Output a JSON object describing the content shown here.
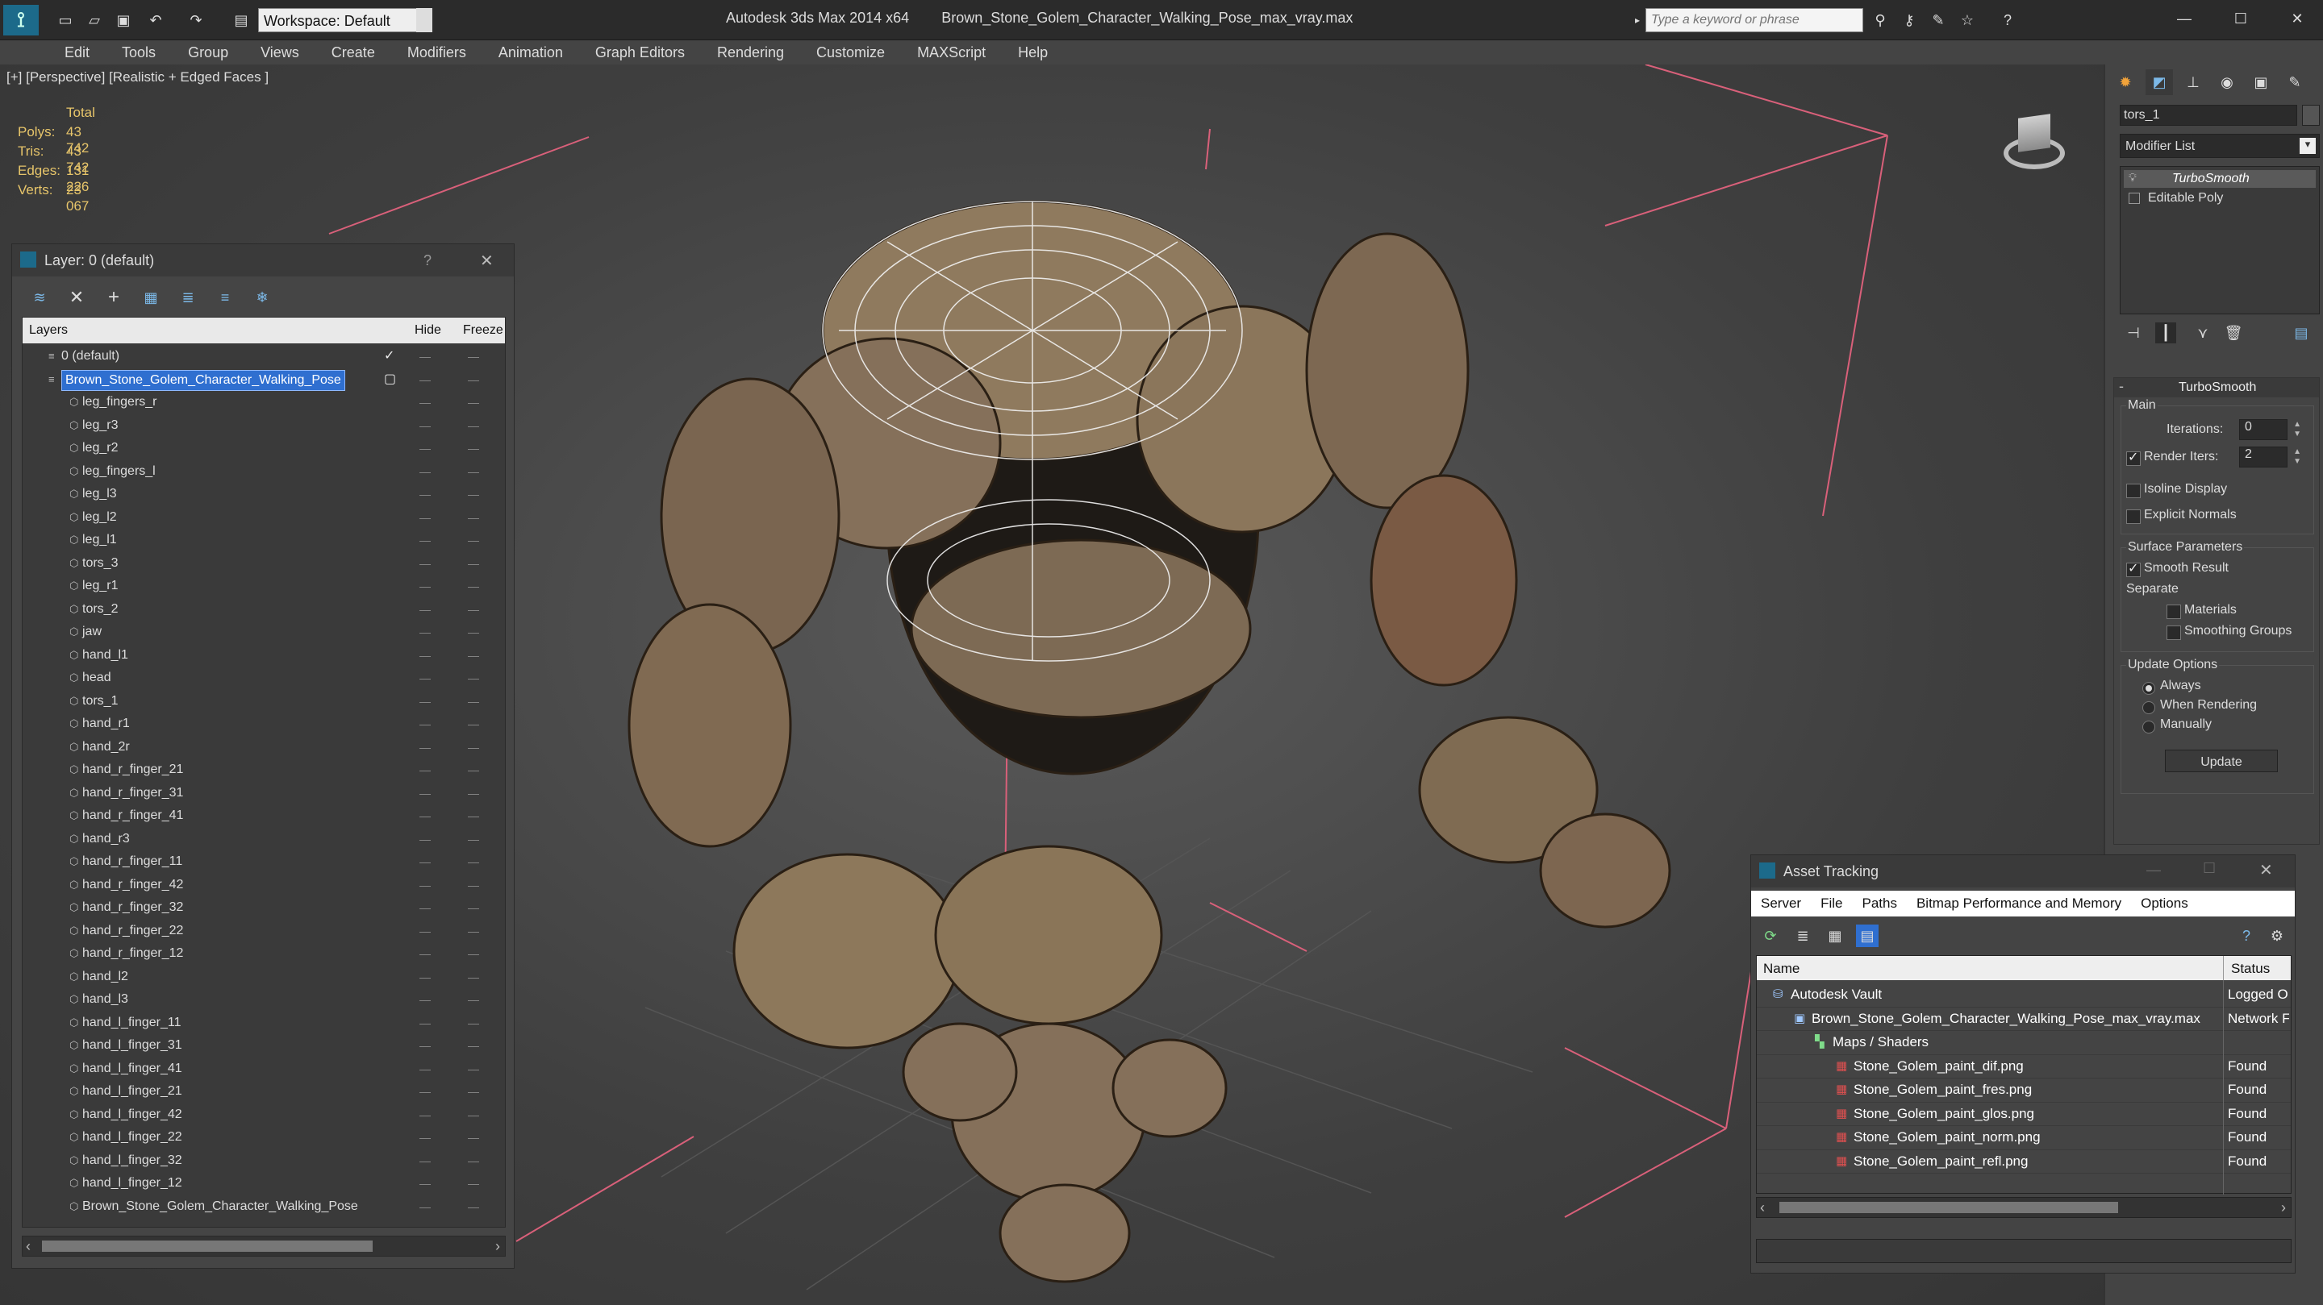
{
  "titlebar": {
    "app_title": "Autodesk 3ds Max  2014 x64",
    "file_title": "Brown_Stone_Golem_Character_Walking_Pose_max_vray.max",
    "workspace": "Workspace: Default",
    "search_placeholder": "Type a keyword or phrase"
  },
  "menu": [
    "Edit",
    "Tools",
    "Group",
    "Views",
    "Create",
    "Modifiers",
    "Animation",
    "Graph Editors",
    "Rendering",
    "Customize",
    "MAXScript",
    "Help"
  ],
  "viewport": {
    "label": "[+] [Perspective] [Realistic + Edged Faces ]",
    "stats_header": "Total",
    "stats": [
      {
        "name": "Polys:",
        "value": "43 742"
      },
      {
        "name": "Tris:",
        "value": "43 742"
      },
      {
        "name": "Edges:",
        "value": "131 226"
      },
      {
        "name": "Verts:",
        "value": "23 067"
      }
    ]
  },
  "layer_panel": {
    "title": "Layer: 0 (default)",
    "help": "?",
    "col_layers": "Layers",
    "col_hide": "Hide",
    "col_freeze": "Freeze",
    "default_layer": "0 (default)",
    "selected_layer": "Brown_Stone_Golem_Character_Walking_Pose",
    "objects": [
      "leg_fingers_r",
      "leg_r3",
      "leg_r2",
      "leg_fingers_l",
      "leg_l3",
      "leg_l2",
      "leg_l1",
      "tors_3",
      "leg_r1",
      "tors_2",
      "jaw",
      "hand_l1",
      "head",
      "tors_1",
      "hand_r1",
      "hand_2r",
      "hand_r_finger_21",
      "hand_r_finger_31",
      "hand_r_finger_41",
      "hand_r3",
      "hand_r_finger_11",
      "hand_r_finger_42",
      "hand_r_finger_32",
      "hand_r_finger_22",
      "hand_r_finger_12",
      "hand_l2",
      "hand_l3",
      "hand_l_finger_11",
      "hand_l_finger_31",
      "hand_l_finger_41",
      "hand_l_finger_21",
      "hand_l_finger_42",
      "hand_l_finger_22",
      "hand_l_finger_32",
      "hand_l_finger_12",
      "Brown_Stone_Golem_Character_Walking_Pose"
    ]
  },
  "command_panel": {
    "object_name": "tors_1",
    "modifier_list": "Modifier List",
    "stack": [
      "TurboSmooth",
      "Editable Poly"
    ],
    "rollout_title": "TurboSmooth",
    "main_label": "Main",
    "iterations_label": "Iterations:",
    "iterations_value": "0",
    "render_iters_label": "Render Iters:",
    "render_iters_value": "2",
    "isoline": "Isoline Display",
    "explicit_normals": "Explicit Normals",
    "surface_params": "Surface Parameters",
    "smooth_result": "Smooth Result",
    "separate": "Separate",
    "materials": "Materials",
    "smoothing_groups": "Smoothing Groups",
    "update_options": "Update Options",
    "always": "Always",
    "when_rendering": "When Rendering",
    "manually": "Manually",
    "update_button": "Update"
  },
  "asset_tracking": {
    "title": "Asset Tracking",
    "menu": [
      "Server",
      "File",
      "Paths",
      "Bitmap Performance and Memory",
      "Options"
    ],
    "col_name": "Name",
    "col_status": "Status",
    "rows": [
      {
        "name": "Autodesk Vault",
        "status": "Logged O",
        "indent": 0
      },
      {
        "name": "Brown_Stone_Golem_Character_Walking_Pose_max_vray.max",
        "status": "Network F",
        "indent": 1
      },
      {
        "name": "Maps / Shaders",
        "status": "",
        "indent": 2
      },
      {
        "name": "Stone_Golem_paint_dif.png",
        "status": "Found",
        "indent": 3
      },
      {
        "name": "Stone_Golem_paint_fres.png",
        "status": "Found",
        "indent": 3
      },
      {
        "name": "Stone_Golem_paint_glos.png",
        "status": "Found",
        "indent": 3
      },
      {
        "name": "Stone_Golem_paint_norm.png",
        "status": "Found",
        "indent": 3
      },
      {
        "name": "Stone_Golem_paint_refl.png",
        "status": "Found",
        "indent": 3
      }
    ]
  },
  "colors": {
    "accent": "#1e90ff",
    "selection": "#2f6fd0",
    "stats_label": "#e7c56a",
    "gizmo_lines": "#d9607a"
  }
}
